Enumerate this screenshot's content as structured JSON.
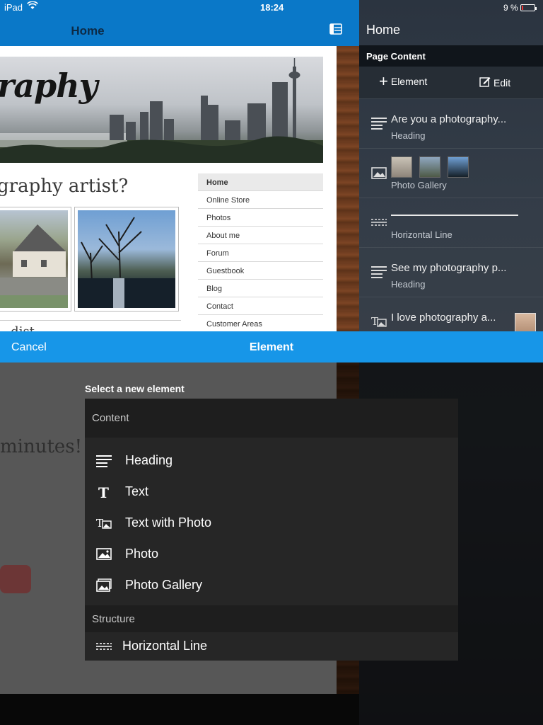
{
  "status_bar": {
    "device": "iPad",
    "time": "18:24",
    "battery": "9 %"
  },
  "left_nav": {
    "title": "Home"
  },
  "site_preview": {
    "logo_text": "raphy",
    "heading": "graphy artist?",
    "body_fragment": "...dist",
    "menu": [
      "Home",
      "Online Store",
      "Photos",
      "About me",
      "Forum",
      "Guestbook",
      "Blog",
      "Contact",
      "Customer Areas"
    ]
  },
  "sidebar": {
    "title": "Home",
    "section": "Page Content",
    "add_element": "Element",
    "edit": "Edit",
    "items": [
      {
        "title": "Are you a photography...",
        "type": "Heading",
        "icon": "heading-icon"
      },
      {
        "title": "",
        "type": "Photo Gallery",
        "icon": "photo-gallery-icon"
      },
      {
        "title": "",
        "type": "Horizontal Line",
        "icon": "horizontal-line-icon"
      },
      {
        "title": "See my photography p...",
        "type": "Heading",
        "icon": "heading-icon"
      },
      {
        "title": "I love photography a...",
        "type": "",
        "icon": "text-with-photo-icon"
      }
    ]
  },
  "modal": {
    "cancel": "Cancel",
    "title": "Element",
    "prompt": "Select a new element",
    "content_header": "Content",
    "content_options": [
      {
        "label": "Heading",
        "icon": "heading-icon"
      },
      {
        "label": "Text",
        "icon": "text-icon"
      },
      {
        "label": "Text with Photo",
        "icon": "text-with-photo-icon"
      },
      {
        "label": "Photo",
        "icon": "photo-icon"
      },
      {
        "label": "Photo Gallery",
        "icon": "photo-gallery-icon"
      }
    ],
    "structure_header": "Structure",
    "structure_options": [
      {
        "label": "Horizontal Line",
        "icon": "horizontal-line-icon"
      }
    ]
  },
  "colors": {
    "accent": "#1796e8",
    "nav_blue": "#0a78c8",
    "sidebar_dark": "#10151b"
  }
}
